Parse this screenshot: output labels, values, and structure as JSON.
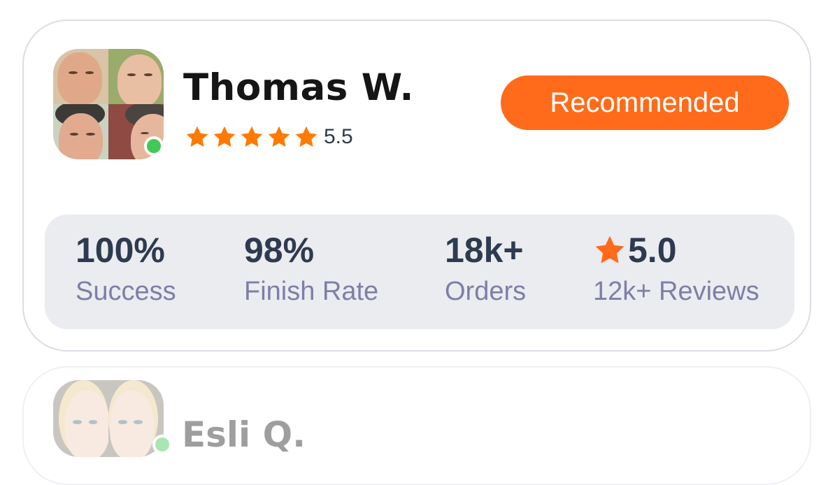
{
  "cards": [
    {
      "name": "Thomas W.",
      "rating": "5.5",
      "stars": 5,
      "online": true,
      "badge": "Recommended",
      "stats": [
        {
          "value": "100%",
          "label": "Success"
        },
        {
          "value": "98%",
          "label": "Finish Rate"
        },
        {
          "value": "18k+",
          "label": "Orders"
        },
        {
          "value": "5.0",
          "label": "12k+ Reviews",
          "icon": "star-icon"
        }
      ]
    },
    {
      "name": "Esli Q.",
      "online": true
    }
  ],
  "colors": {
    "accent": "#ff6b1a",
    "star": "#ff7a00",
    "online": "#40c957",
    "stats_bg": "#ebecf0",
    "stat_value": "#2e3a4f",
    "stat_label": "#7d7fa6"
  }
}
